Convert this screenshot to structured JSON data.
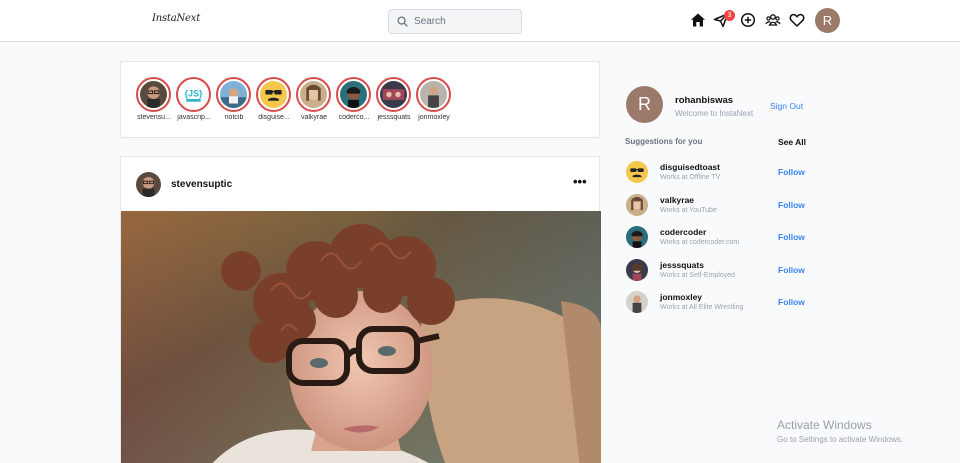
{
  "app": {
    "logo": "InstaNext"
  },
  "search": {
    "placeholder": "Search"
  },
  "header": {
    "icons": [
      "home-icon",
      "paper-plane-icon",
      "plus-circle-icon",
      "user-group-icon",
      "heart-icon"
    ],
    "dm_badge_count": "3",
    "avatar_letter": "R"
  },
  "stories": [
    {
      "label": "stevensu..."
    },
    {
      "label": "javascrip..."
    },
    {
      "label": "notcib"
    },
    {
      "label": "disguise..."
    },
    {
      "label": "valkyrae"
    },
    {
      "label": "coderco..."
    },
    {
      "label": "jesssquats"
    },
    {
      "label": "jonmoxley"
    }
  ],
  "post": {
    "username": "stevensuptic",
    "more": "•••"
  },
  "sidebar": {
    "avatar_letter": "R",
    "username": "rohanbiswas",
    "subtitle": "Welcome to InstaNext",
    "sign_out": "Sign Out",
    "suggestions_title": "Suggestions for you",
    "see_all": "See All",
    "suggestions": [
      {
        "name": "disguisedtoast",
        "sub": "Works at Offline TV",
        "follow": "Follow"
      },
      {
        "name": "valkyrae",
        "sub": "Works at YouTube",
        "follow": "Follow"
      },
      {
        "name": "codercoder",
        "sub": "Works at codercoder.com",
        "follow": "Follow"
      },
      {
        "name": "jesssquats",
        "sub": "Works at Self-Employed",
        "follow": "Follow"
      },
      {
        "name": "jonmoxley",
        "sub": "Works at All Elite Wrestling",
        "follow": "Follow"
      }
    ]
  },
  "watermark": {
    "title": "Activate Windows",
    "subtitle": "Go to Settings to activate Windows."
  },
  "colors": {
    "accent": "#3b82f6",
    "story_ring": "#d94b4b",
    "badge": "#ef4444",
    "avatar_bg": "#9c7a6b"
  }
}
